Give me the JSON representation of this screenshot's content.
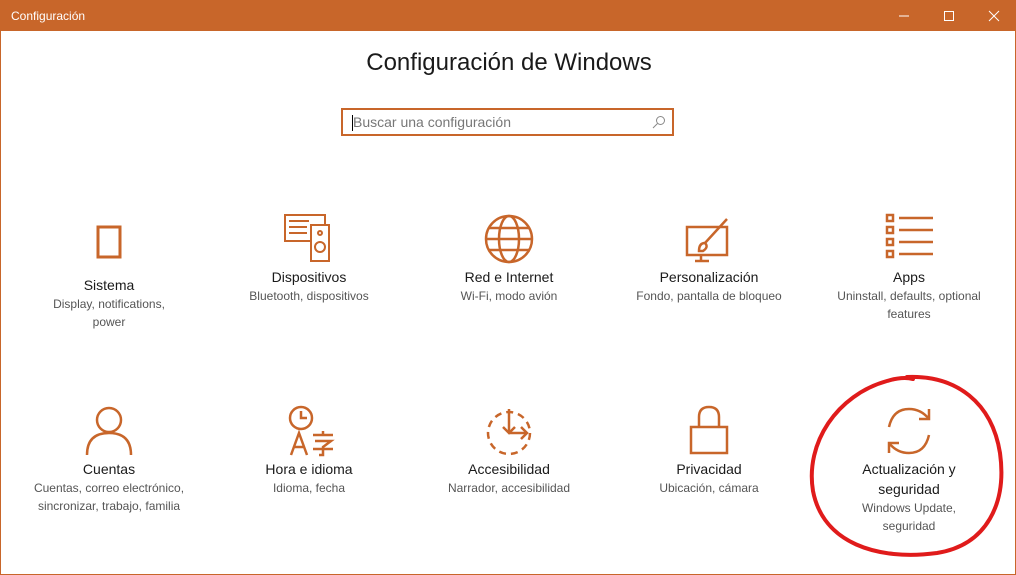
{
  "window": {
    "title": "Configuración"
  },
  "header": {
    "title": "Configuración de Windows"
  },
  "search": {
    "placeholder": "Buscar una configuración"
  },
  "categories": [
    {
      "name": "Sistema",
      "description": "Display, notifications, power",
      "icon": "laptop-icon"
    },
    {
      "name": "Dispositivos",
      "description": "Bluetooth, dispositivos",
      "icon": "keyboard-speaker-icon"
    },
    {
      "name": "Red e Internet",
      "description": "Wi-Fi, modo avión",
      "icon": "globe-icon"
    },
    {
      "name": "Personalización",
      "description": "Fondo, pantalla de bloqueo",
      "icon": "paint-brush-icon"
    },
    {
      "name": "Apps",
      "description": "Uninstall, defaults, optional features",
      "icon": "app-list-icon"
    },
    {
      "name": "Cuentas",
      "description": "Cuentas, correo electrónico, sincronizar, trabajo, familia",
      "icon": "person-icon"
    },
    {
      "name": "Hora e idioma",
      "description": "Idioma, fecha",
      "icon": "time-language-icon"
    },
    {
      "name": "Accesibilidad",
      "description": "Narrador, accesibilidad",
      "icon": "ease-of-access-icon"
    },
    {
      "name": "Privacidad",
      "description": "Ubicación, cámara",
      "icon": "lock-icon"
    },
    {
      "name": "Actualización y seguridad",
      "description": "Windows Update, seguridad",
      "icon": "sync-arrows-icon"
    }
  ],
  "colors": {
    "accent": "#c8662a",
    "annotation": "#e01b1b"
  }
}
